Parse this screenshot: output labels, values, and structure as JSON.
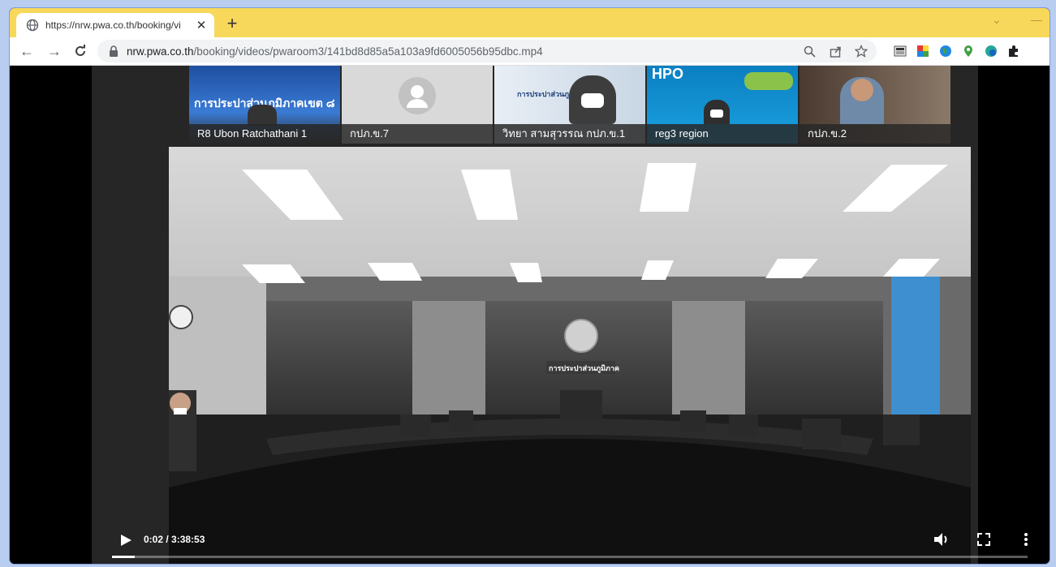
{
  "tab": {
    "title": "https://nrw.pwa.co.th/booking/vi",
    "close_symbol": "✕",
    "new_tab_symbol": "+"
  },
  "window": {
    "chevron": "⌄",
    "minimize": "—"
  },
  "address": {
    "host": "nrw.pwa.co.th",
    "path": "/booking/videos/pwaroom3/141bd8d85a5a103a9fd6005056b95dbc.mp4"
  },
  "video": {
    "participants": [
      {
        "label": "R8 Ubon Ratchathani 1",
        "screen_text": "การประปาส่วนภูมิภาคเขต ๘"
      },
      {
        "label": "กปภ.ข.7"
      },
      {
        "label": "วิทยา สามสุวรรณ กปภ.ข.1",
        "screen_text": "การประปาส่วนภูมิภาค"
      },
      {
        "label": "reg3 region",
        "screen_text": "HPO"
      },
      {
        "label": "กปภ.ข.2"
      }
    ],
    "room_sign": "การประปาส่วนภูมิภาค",
    "time_display": "0:02 / 3:38:53",
    "progress_fraction": 0.0003
  },
  "colors": {
    "tabstrip": "#f7d85a",
    "page_bg": "#b9cdf0"
  }
}
